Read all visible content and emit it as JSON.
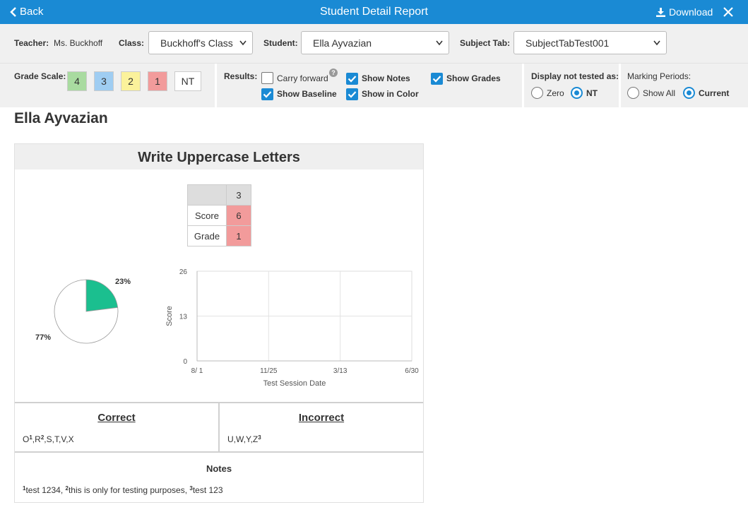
{
  "header": {
    "back_label": "Back",
    "title": "Student Detail Report",
    "download_label": "Download"
  },
  "selection": {
    "teacher_label": "Teacher:",
    "teacher_value": "Ms. Buckhoff",
    "class_label": "Class:",
    "class_value": "Buckhoff's Class",
    "student_label": "Student:",
    "student_value": "Ella Ayvazian",
    "subject_label": "Subject Tab:",
    "subject_value": "SubjectTabTest001"
  },
  "grade_scale": {
    "label": "Grade Scale:",
    "grades": [
      {
        "label": "4",
        "color": "#a9dba0"
      },
      {
        "label": "3",
        "color": "#9fcdf2"
      },
      {
        "label": "2",
        "color": "#fbf29b"
      },
      {
        "label": "1",
        "color": "#f29b9b"
      },
      {
        "label": "NT",
        "color": "#ffffff"
      }
    ]
  },
  "results": {
    "label": "Results:",
    "options": [
      {
        "label": "Carry forward",
        "checked": false
      },
      {
        "label": "Show Notes",
        "checked": true
      },
      {
        "label": "Show Grades",
        "checked": true
      },
      {
        "label": "Show Baseline",
        "checked": true
      },
      {
        "label": "Show in Color",
        "checked": true
      }
    ],
    "help_glyph": "?"
  },
  "not_tested": {
    "label": "Display not tested as:",
    "options": [
      {
        "label": "Zero",
        "selected": false
      },
      {
        "label": "NT",
        "selected": true
      }
    ]
  },
  "marking_periods": {
    "label": "Marking Periods:",
    "options": [
      {
        "label": "Show All",
        "selected": false
      },
      {
        "label": "Current",
        "selected": true
      }
    ]
  },
  "student_name": "Ella Ayvazian",
  "card": {
    "title": "Write Uppercase Letters",
    "score_table": {
      "column": "3",
      "rows": [
        {
          "label": "Score",
          "value": "6"
        },
        {
          "label": "Grade",
          "value": "1"
        }
      ]
    },
    "correct_title": "Correct",
    "incorrect_title": "Incorrect",
    "correct_items": [
      {
        "letter": "O",
        "note": "1"
      },
      {
        "letter": "R",
        "note": "2"
      },
      {
        "letter": "S",
        "note": ""
      },
      {
        "letter": "T",
        "note": ""
      },
      {
        "letter": "V",
        "note": ""
      },
      {
        "letter": "X",
        "note": ""
      }
    ],
    "incorrect_items": [
      {
        "letter": "U",
        "note": ""
      },
      {
        "letter": "W",
        "note": ""
      },
      {
        "letter": "Y",
        "note": ""
      },
      {
        "letter": "Z",
        "note": "3"
      }
    ],
    "notes_title": "Notes",
    "notes": [
      {
        "num": "1",
        "text": "test 1234"
      },
      {
        "num": "2",
        "text": "this is only for testing purposes"
      },
      {
        "num": "3",
        "text": "test 123"
      }
    ]
  },
  "chart_data": [
    {
      "type": "pie",
      "values": [
        23,
        77
      ],
      "labels": [
        "23%",
        "77%"
      ],
      "colors": [
        "#1bbf8f",
        "#ffffff"
      ]
    },
    {
      "type": "line",
      "xlabel": "Test Session Date",
      "ylabel": "Score",
      "ylim": [
        0,
        26
      ],
      "yticks": [
        "0",
        "13",
        "26"
      ],
      "xticks": [
        "8/ 1",
        "11/25",
        "3/13",
        "6/30"
      ],
      "grid": true,
      "series": []
    }
  ],
  "colors": {
    "accent": "#1a8ad4",
    "grade_one": "#f29b9b"
  }
}
